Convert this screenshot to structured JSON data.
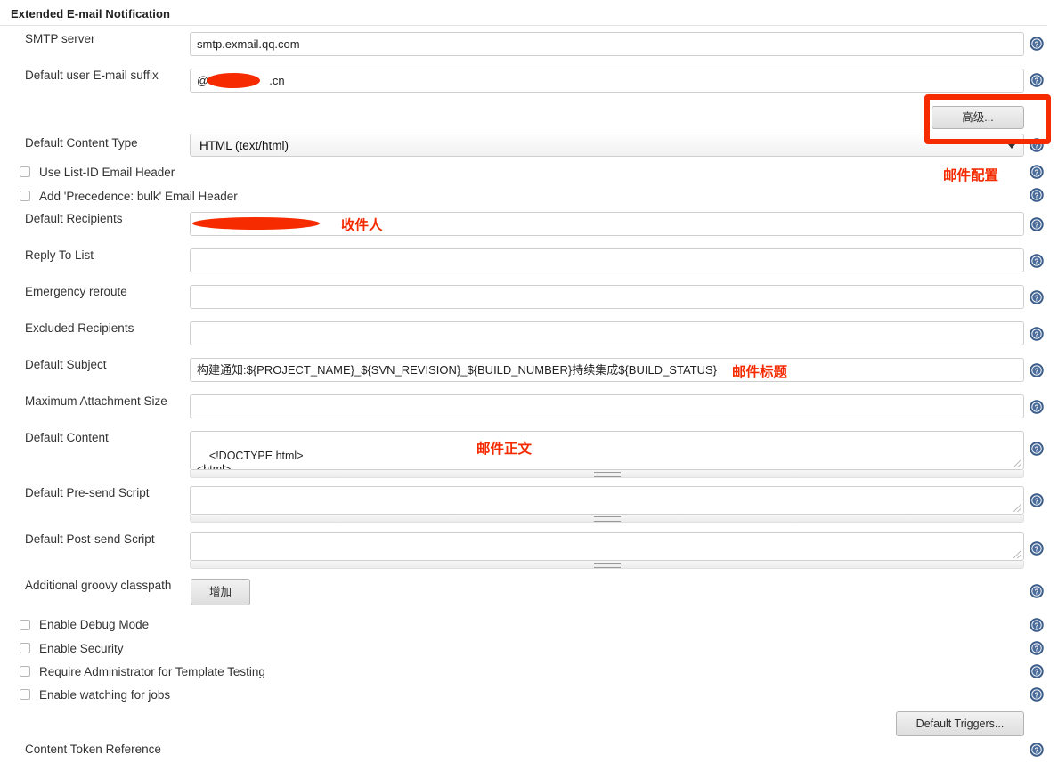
{
  "section": {
    "title": "Extended E-mail Notification"
  },
  "fields": {
    "smtp_server": {
      "label": "SMTP server",
      "value": "smtp.exmail.qq.com"
    },
    "email_suffix": {
      "label": "Default user E-mail suffix",
      "value_prefix": "@",
      "value_suffix": ".cn"
    },
    "content_type": {
      "label": "Default Content Type",
      "value": "HTML (text/html)"
    },
    "default_recipients": {
      "label": "Default Recipients",
      "value": ""
    },
    "reply_to_list": {
      "label": "Reply To List",
      "value": ""
    },
    "emergency_reroute": {
      "label": "Emergency reroute",
      "value": ""
    },
    "excluded_recipients": {
      "label": "Excluded Recipients",
      "value": ""
    },
    "default_subject": {
      "label": "Default Subject",
      "value": "构建通知:${PROJECT_NAME}_${SVN_REVISION}_${BUILD_NUMBER}持续集成${BUILD_STATUS}"
    },
    "max_attachment_size": {
      "label": "Maximum Attachment Size",
      "value": ""
    },
    "default_content": {
      "label": "Default Content",
      "value": "<!DOCTYPE html>\n<html>\n<head>"
    },
    "pre_send_script": {
      "label": "Default Pre-send Script",
      "value": ""
    },
    "post_send_script": {
      "label": "Default Post-send Script",
      "value": ""
    },
    "groovy_classpath": {
      "label": "Additional groovy classpath"
    },
    "content_token_reference": {
      "label": "Content Token Reference"
    }
  },
  "checkboxes": [
    {
      "label": "Use List-ID Email Header",
      "checked": false
    },
    {
      "label": "Add 'Precedence: bulk' Email Header",
      "checked": false
    },
    {
      "label": "Enable Debug Mode",
      "checked": false
    },
    {
      "label": "Enable Security",
      "checked": false
    },
    {
      "label": "Require Administrator for Template Testing",
      "checked": false
    },
    {
      "label": "Enable watching for jobs",
      "checked": false
    }
  ],
  "buttons": {
    "advanced": "高级...",
    "add_classpath": "增加",
    "default_triggers": "Default Triggers..."
  },
  "annotations": {
    "mail_config": "邮件配置",
    "recipient": "收件人",
    "mail_subject": "邮件标题",
    "mail_body": "邮件正文"
  },
  "colors": {
    "annotation_red": "#f42a00",
    "redaction_red": "#f72b00",
    "help_blue": "#4a6c9b",
    "border_gray": "#cfcfcf"
  }
}
